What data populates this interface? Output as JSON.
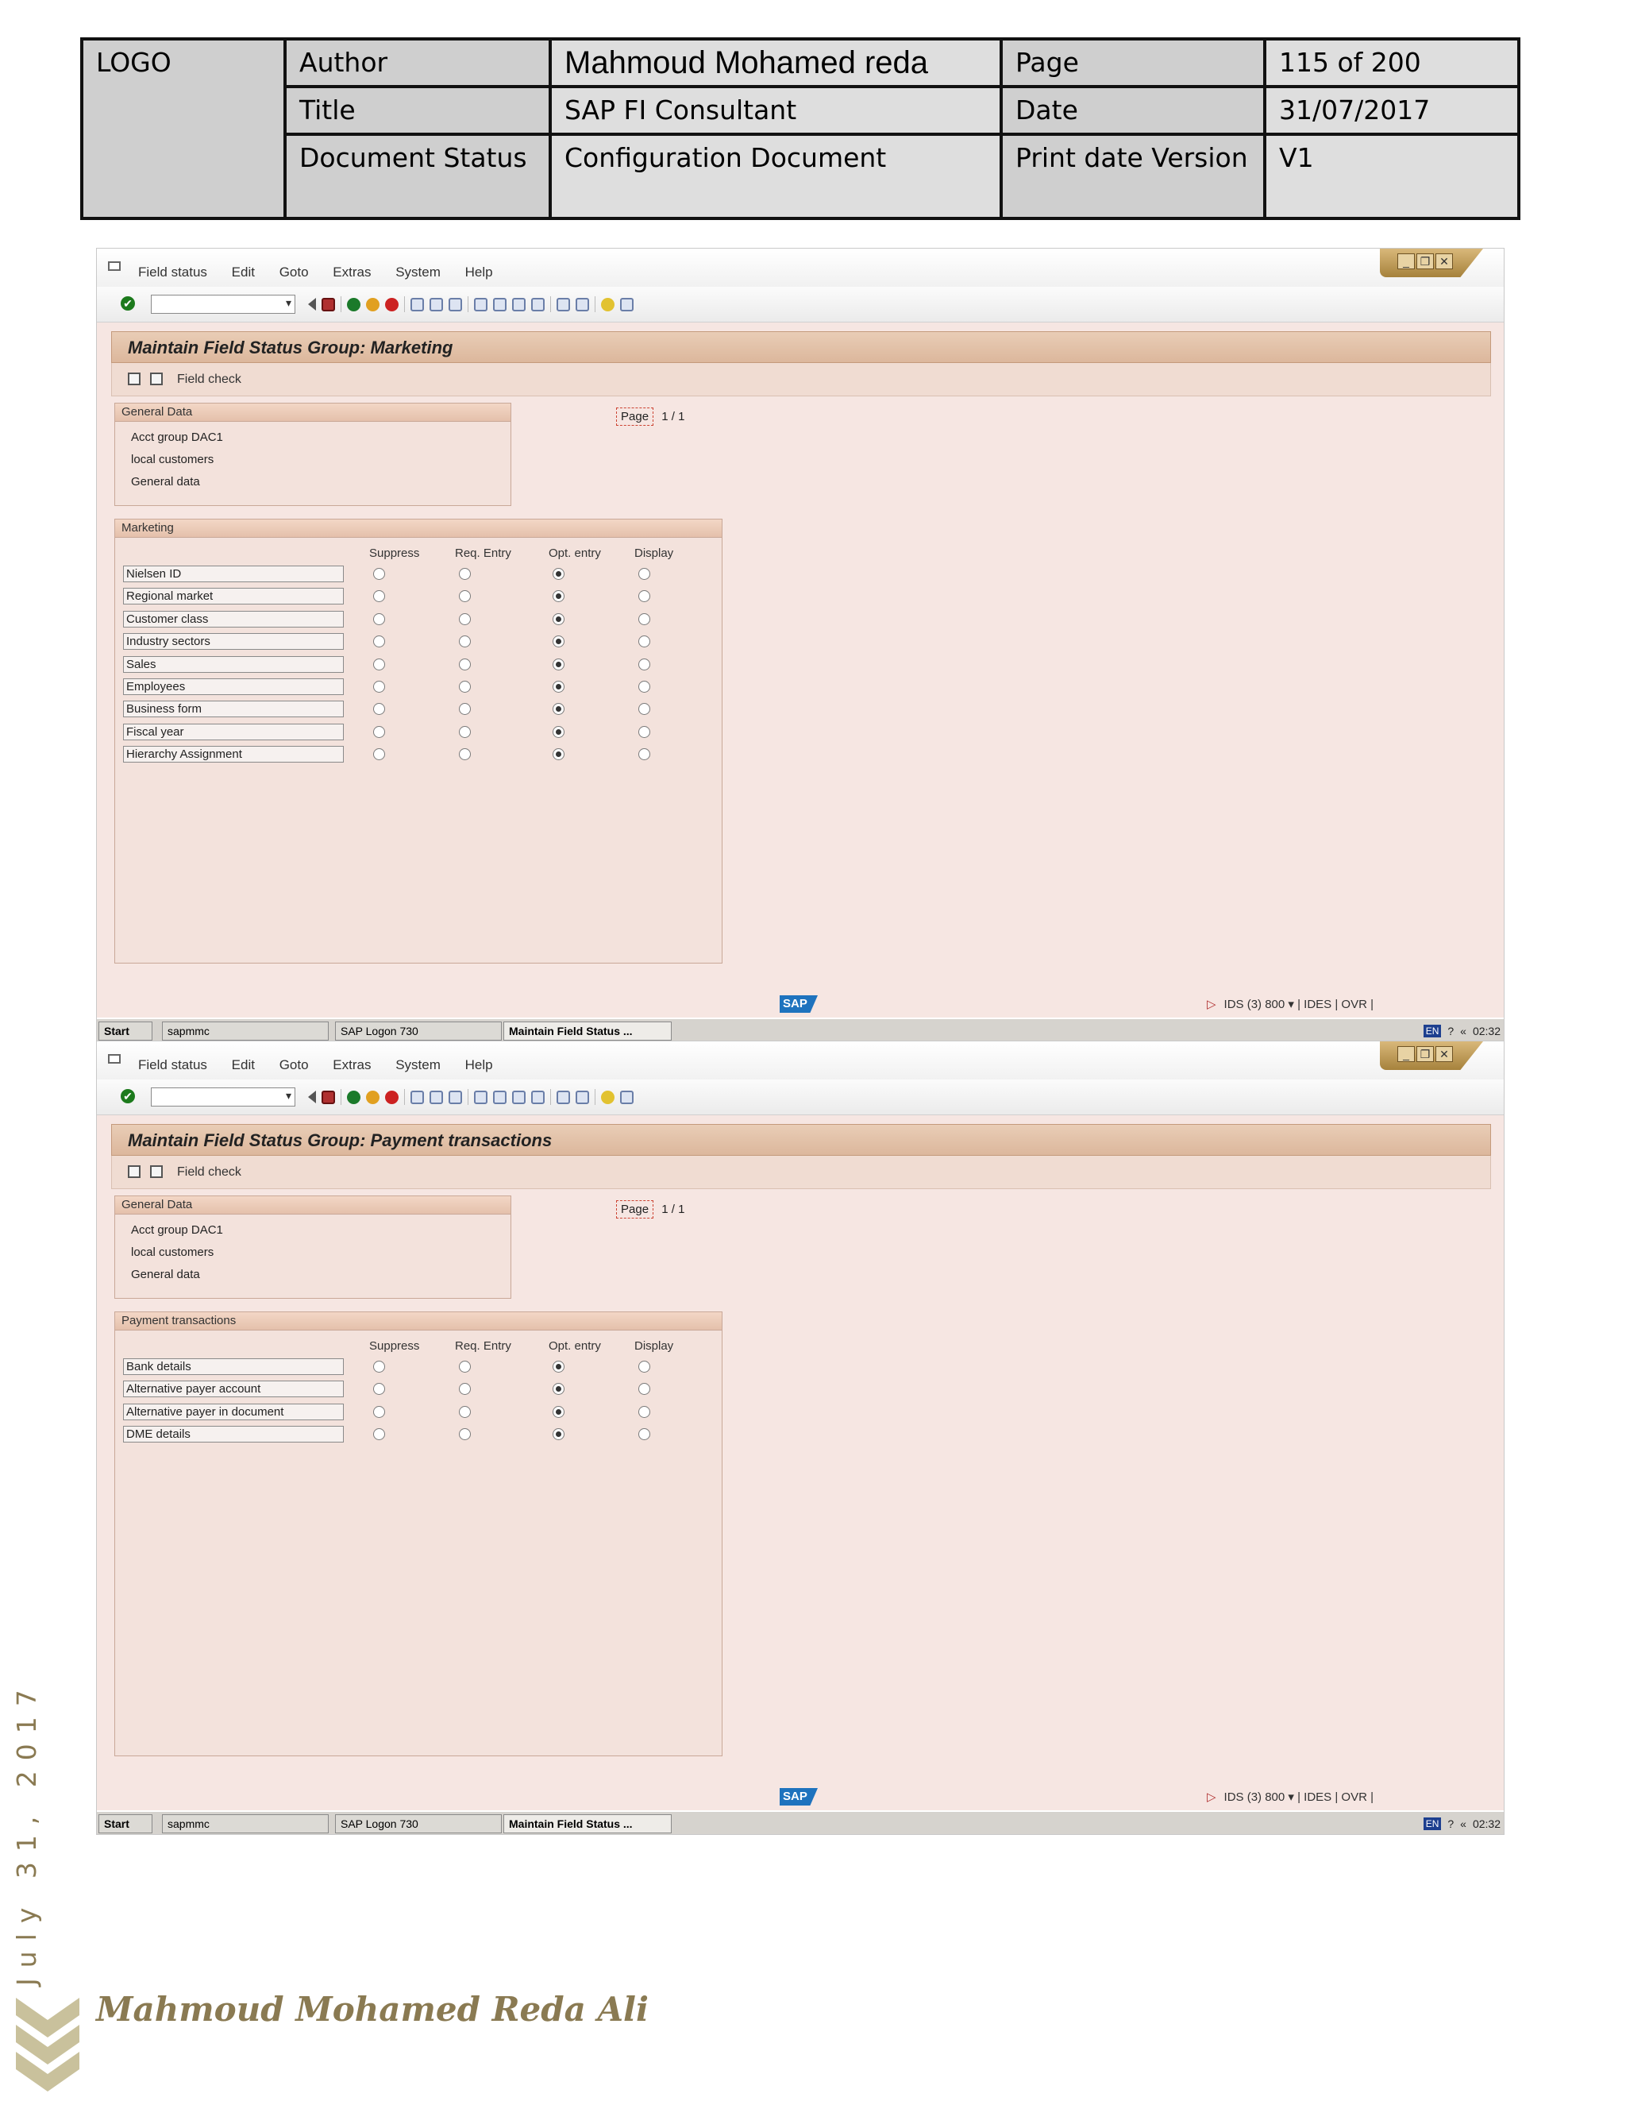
{
  "header": {
    "logo": "LOGO",
    "author_label": "Author",
    "author_value": "Mahmoud Mohamed reda",
    "page_label": "Page",
    "page_value": "115 of 200",
    "title_label": "Title",
    "title_value": "SAP FI Consultant",
    "date_label": "Date",
    "date_value": "31/07/2017",
    "status_label": "Document Status",
    "status_value": "Configuration Document",
    "print_label": "Print date Version",
    "print_value": "V1"
  },
  "menu": [
    "Field status",
    "Edit",
    "Goto",
    "Extras",
    "System",
    "Help"
  ],
  "common": {
    "field_check": "Field check",
    "general_data_head": "General Data",
    "acct_group_line": "Acct group   DAC1",
    "local_customers": "local customers",
    "general_data_line": "General data",
    "page_label": "Page",
    "page_count": "1  /  1",
    "col_suppress": "Suppress",
    "col_req": "Req. Entry",
    "col_opt": "Opt. entry",
    "col_display": "Display",
    "sap_logo": "SAP",
    "status_text": "IDS (3) 800 ▾  |  IDES  |  OVR  |",
    "taskbar_start": "Start",
    "taskbar_1": "sapmmc",
    "taskbar_2": "SAP Logon 730",
    "taskbar_3": "Maintain Field Status ...",
    "lang": "EN",
    "clock": "02:32"
  },
  "window1": {
    "title": "Maintain Field Status Group: Marketing",
    "group_title": "Marketing",
    "rows": [
      {
        "label": "Nielsen ID",
        "selected": "opt"
      },
      {
        "label": "Regional market",
        "selected": "opt"
      },
      {
        "label": "Customer class",
        "selected": "opt"
      },
      {
        "label": "Industry sectors",
        "selected": "opt"
      },
      {
        "label": "Sales",
        "selected": "opt"
      },
      {
        "label": "Employees",
        "selected": "opt"
      },
      {
        "label": "Business form",
        "selected": "opt"
      },
      {
        "label": "Fiscal year",
        "selected": "opt"
      },
      {
        "label": "Hierarchy Assignment",
        "selected": "opt"
      }
    ]
  },
  "window2": {
    "title": "Maintain Field Status Group: Payment transactions",
    "group_title": "Payment transactions",
    "rows": [
      {
        "label": "Bank details",
        "selected": "opt"
      },
      {
        "label": "Alternative payer account",
        "selected": "opt"
      },
      {
        "label": "Alternative payer in document",
        "selected": "opt"
      },
      {
        "label": "DME details",
        "selected": "opt"
      }
    ]
  },
  "footer": {
    "side_date": "July 31, 2017",
    "author_name": "Mahmoud Mohamed Reda Ali"
  }
}
